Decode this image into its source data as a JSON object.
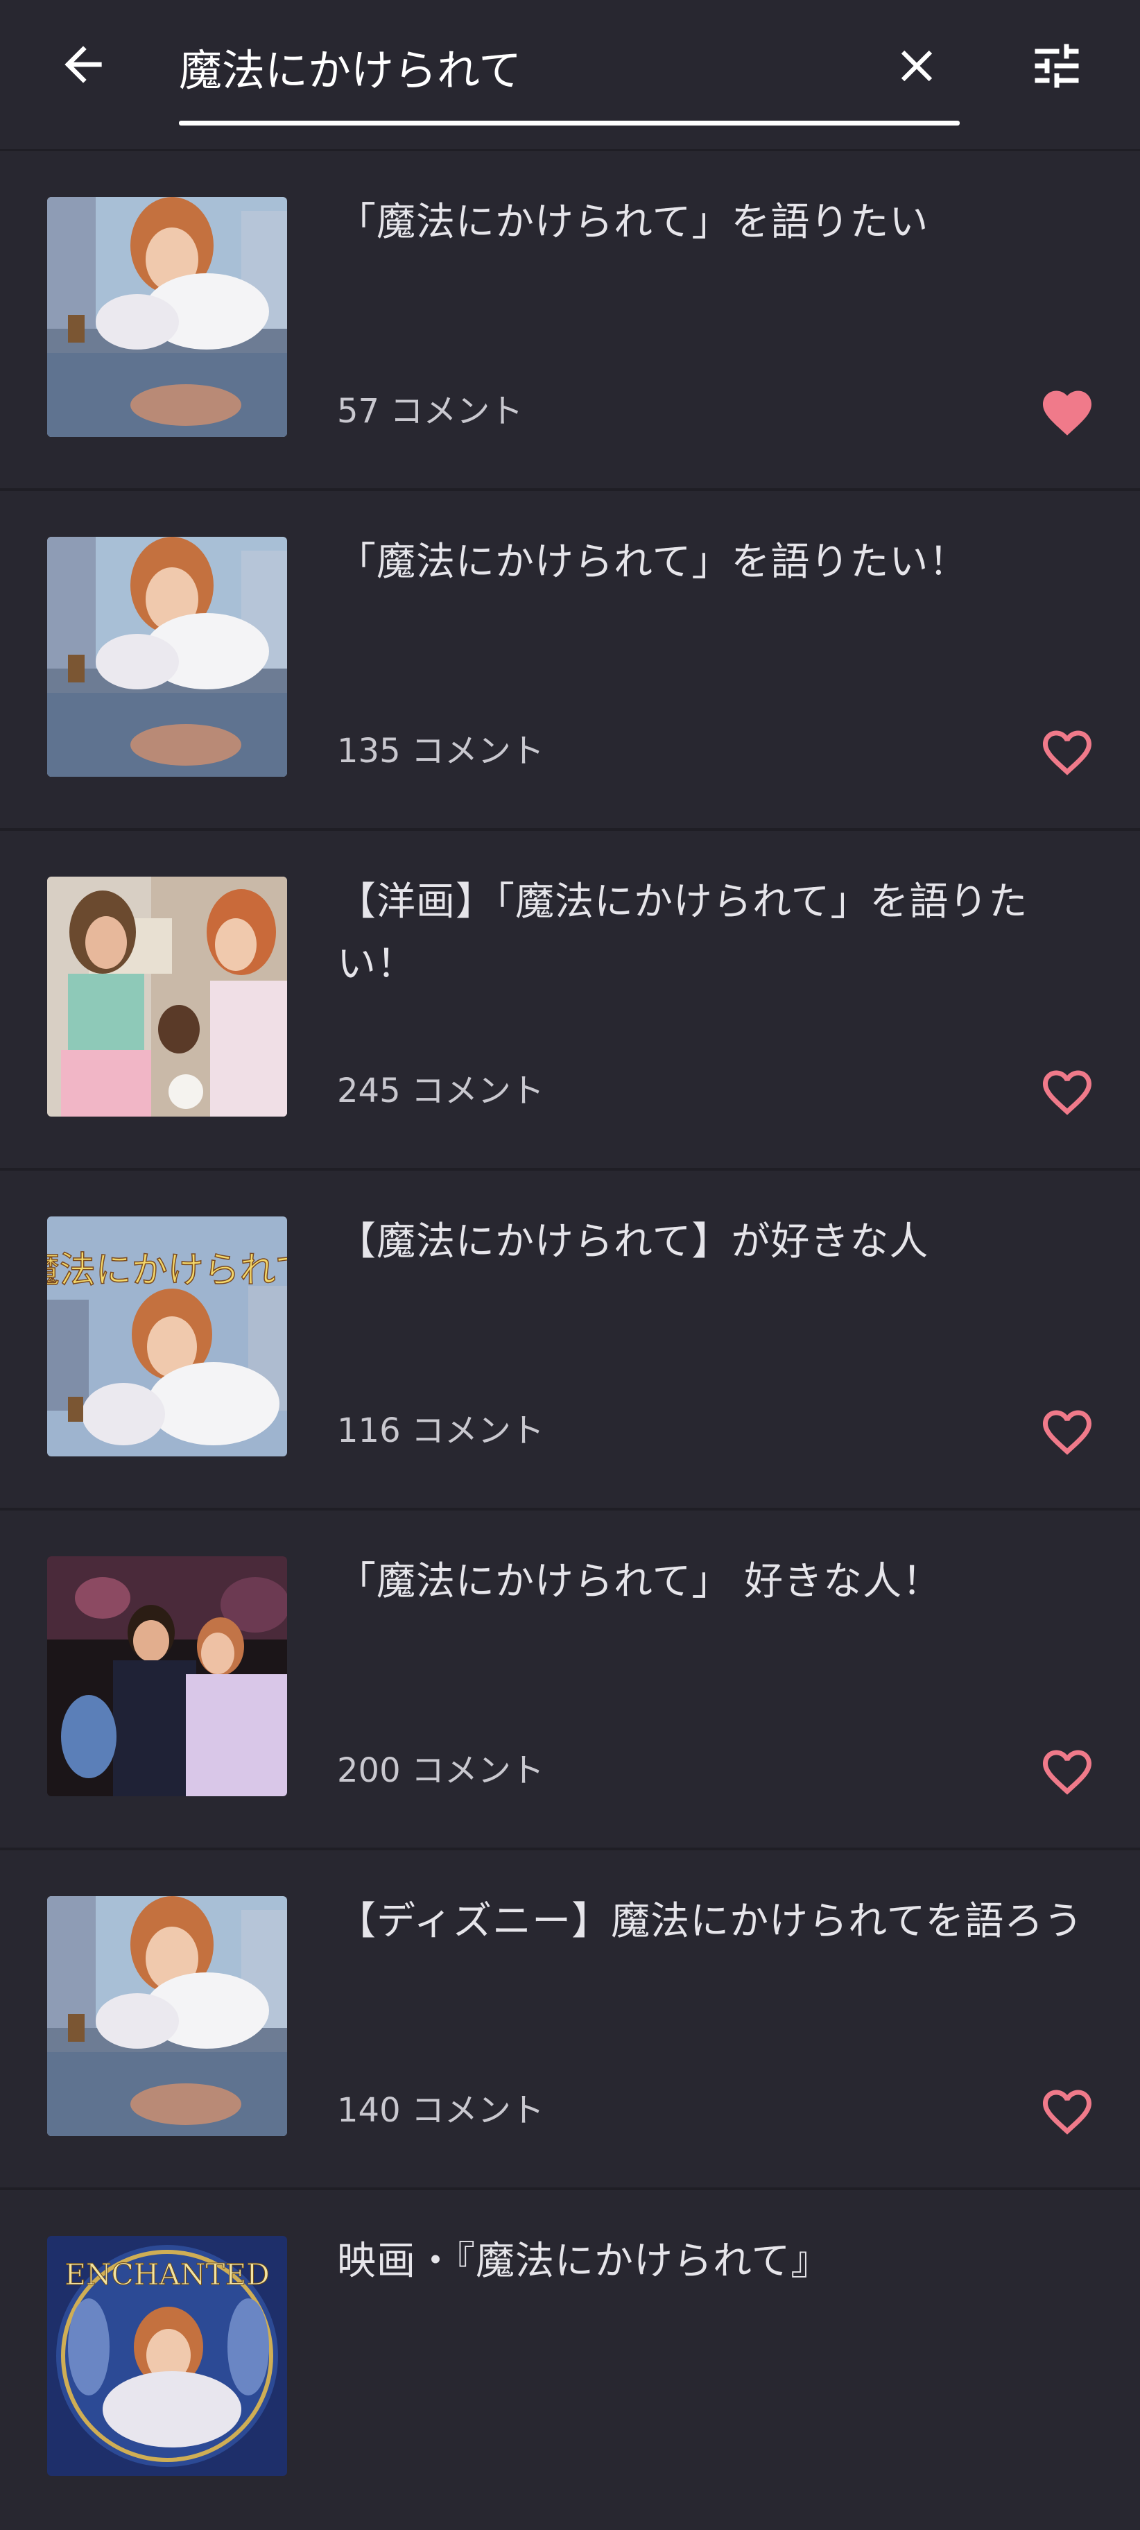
{
  "search": {
    "value": "魔法にかけられて",
    "placeholder": ""
  },
  "colors": {
    "background": "#282730",
    "heart": "#f07a8a",
    "text": "#e6e5ea"
  },
  "results": [
    {
      "title": "「魔法にかけられて」を語りたい",
      "comments": "57 コメント",
      "favorited": true,
      "thumb_label": ""
    },
    {
      "title": "「魔法にかけられて」を語りたい！",
      "comments": "135 コメント",
      "favorited": false,
      "thumb_label": ""
    },
    {
      "title": "【洋画】「魔法にかけられて」を語りたい！",
      "comments": "245 コメント",
      "favorited": false,
      "thumb_label": ""
    },
    {
      "title": "【魔法にかけられて】が好きな人",
      "comments": "116 コメント",
      "favorited": false,
      "thumb_label": "魔法にかけられて"
    },
    {
      "title": "「魔法にかけられて」 好きな人！",
      "comments": "200 コメント",
      "favorited": false,
      "thumb_label": ""
    },
    {
      "title": "【ディズニー】魔法にかけられてを語ろう",
      "comments": "140 コメント",
      "favorited": false,
      "thumb_label": ""
    },
    {
      "title": "映画・『魔法にかけられて』",
      "comments": "",
      "favorited": false,
      "thumb_label": "ENCHANTED"
    }
  ]
}
